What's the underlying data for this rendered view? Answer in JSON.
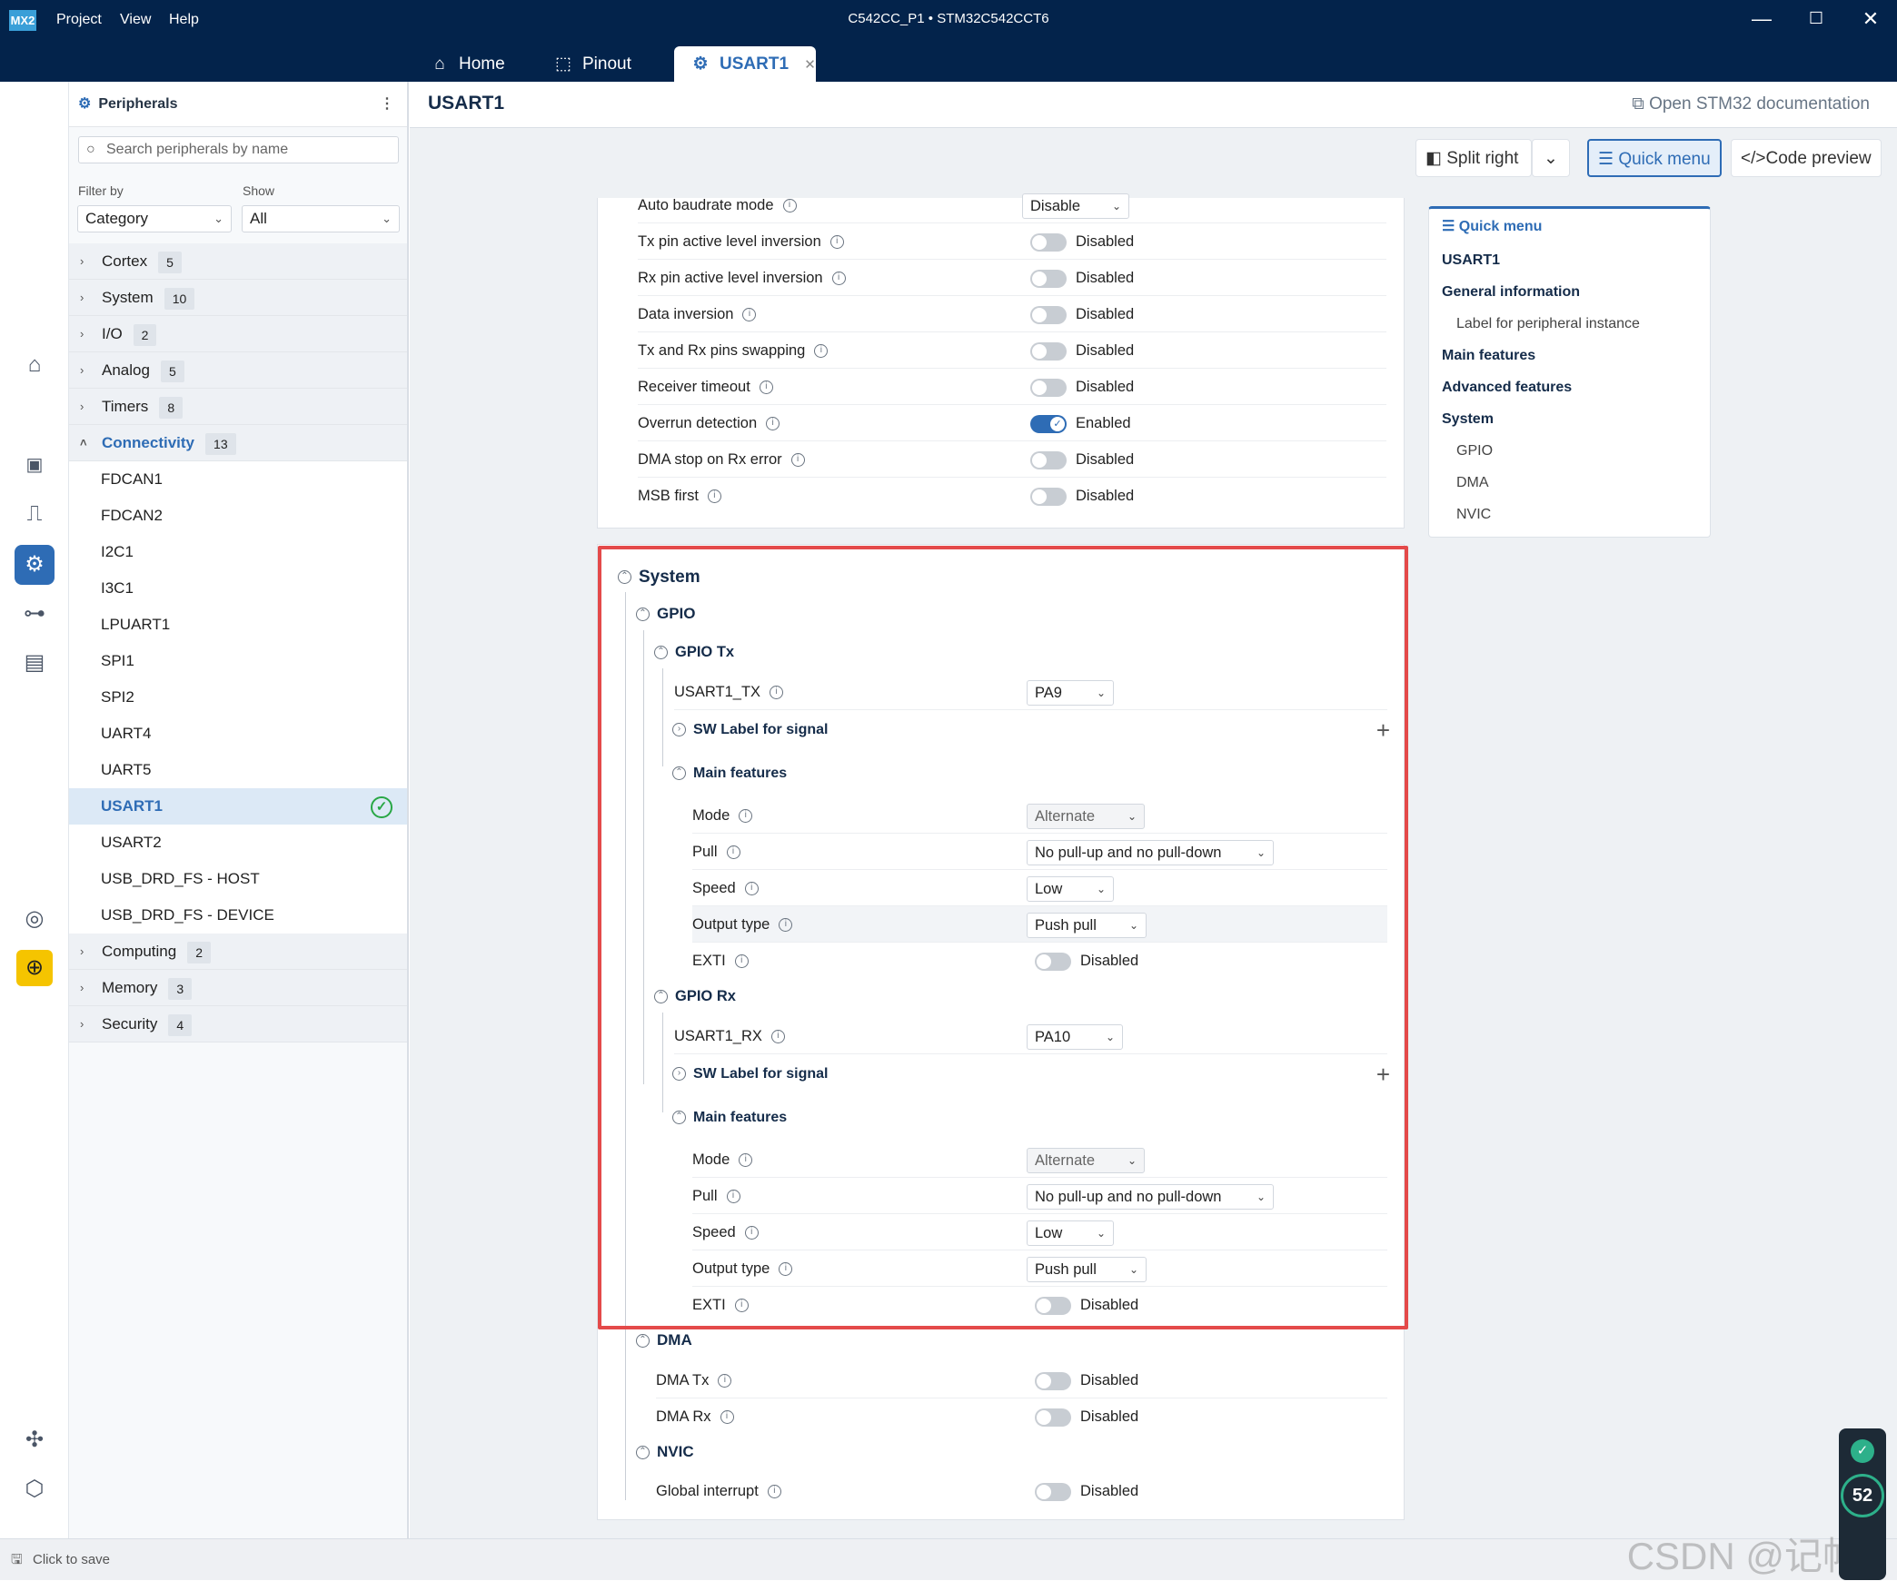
{
  "app": {
    "logo": "MX2",
    "menu": [
      "Project",
      "View",
      "Help"
    ],
    "window_title": "C542CC_P1  •  STM32C542CCT6"
  },
  "tabs": [
    {
      "label": "Home",
      "icon": "home-icon"
    },
    {
      "label": "Pinout",
      "icon": "chip-icon"
    },
    {
      "label": "USART1",
      "icon": "peripherals-icon"
    }
  ],
  "sidebar": {
    "title": "Peripherals",
    "search_placeholder": "Search peripherals by name",
    "filter_label": "Filter by",
    "filter_value": "Category",
    "show_label": "Show",
    "show_value": "All",
    "categories": [
      {
        "label": "Cortex",
        "count": "5"
      },
      {
        "label": "System",
        "count": "10"
      },
      {
        "label": "I/O",
        "count": "2"
      },
      {
        "label": "Analog",
        "count": "5"
      },
      {
        "label": "Timers",
        "count": "8"
      },
      {
        "label": "Connectivity",
        "count": "13"
      }
    ],
    "connectivity_items": [
      "FDCAN1",
      "FDCAN2",
      "I2C1",
      "I3C1",
      "LPUART1",
      "SPI1",
      "SPI2",
      "UART4",
      "UART5",
      "USART1",
      "USART2",
      "USB_DRD_FS - HOST",
      "USB_DRD_FS - DEVICE"
    ],
    "categories_after": [
      {
        "label": "Computing",
        "count": "2"
      },
      {
        "label": "Memory",
        "count": "3"
      },
      {
        "label": "Security",
        "count": "4"
      }
    ]
  },
  "main": {
    "title": "USART1",
    "doc_link": "Open STM32 documentation",
    "toolbar": {
      "split": "Split right",
      "quick_menu": "Quick menu",
      "code_preview": "Code preview"
    },
    "advanced_rows": [
      {
        "label": "Auto baudrate mode",
        "value": "Disable",
        "type": "select"
      },
      {
        "label": "Tx pin active level inversion",
        "value": "Disabled",
        "type": "toggle"
      },
      {
        "label": "Rx pin active level inversion",
        "value": "Disabled",
        "type": "toggle"
      },
      {
        "label": "Data inversion",
        "value": "Disabled",
        "type": "toggle"
      },
      {
        "label": "Tx and Rx pins swapping",
        "value": "Disabled",
        "type": "toggle"
      },
      {
        "label": "Receiver timeout",
        "value": "Disabled",
        "type": "toggle"
      },
      {
        "label": "Overrun detection",
        "value": "Enabled",
        "type": "toggle-on"
      },
      {
        "label": "DMA stop on Rx error",
        "value": "Disabled",
        "type": "toggle"
      },
      {
        "label": "MSB first",
        "value": "Disabled",
        "type": "toggle"
      }
    ],
    "system": {
      "title": "System",
      "gpio": "GPIO",
      "gpio_tx": {
        "title": "GPIO Tx",
        "pin_label": "USART1_TX",
        "pin_value": "PA9",
        "sw_label": "SW Label for signal",
        "main_features": "Main features",
        "rows": [
          {
            "label": "Mode",
            "value": "Alternate"
          },
          {
            "label": "Pull",
            "value": "No pull-up and no pull-down"
          },
          {
            "label": "Speed",
            "value": "Low"
          },
          {
            "label": "Output type",
            "value": "Push pull"
          },
          {
            "label": "EXTI",
            "value": "Disabled"
          }
        ]
      },
      "gpio_rx": {
        "title": "GPIO Rx",
        "pin_label": "USART1_RX",
        "pin_value": "PA10",
        "sw_label": "SW Label for signal",
        "main_features": "Main features",
        "rows": [
          {
            "label": "Mode",
            "value": "Alternate"
          },
          {
            "label": "Pull",
            "value": "No pull-up and no pull-down"
          },
          {
            "label": "Speed",
            "value": "Low"
          },
          {
            "label": "Output type",
            "value": "Push pull"
          },
          {
            "label": "EXTI",
            "value": "Disabled"
          }
        ]
      },
      "dma": {
        "title": "DMA",
        "rows": [
          {
            "label": "DMA Tx",
            "value": "Disabled"
          },
          {
            "label": "DMA Rx",
            "value": "Disabled"
          }
        ]
      },
      "nvic": {
        "title": "NVIC",
        "rows": [
          {
            "label": "Global interrupt",
            "value": "Disabled"
          }
        ]
      }
    }
  },
  "quick_menu": {
    "title": "Quick menu",
    "items": [
      {
        "label": "USART1",
        "level": 1
      },
      {
        "label": "General information",
        "level": 1
      },
      {
        "label": "Label for peripheral instance",
        "level": 2
      },
      {
        "label": "Main features",
        "level": 1
      },
      {
        "label": "Advanced features",
        "level": 1
      },
      {
        "label": "System",
        "level": 1
      },
      {
        "label": "GPIO",
        "level": 2
      },
      {
        "label": "DMA",
        "level": 2
      },
      {
        "label": "NVIC",
        "level": 2
      }
    ]
  },
  "status": {
    "save": "Click to save",
    "score": "52",
    "watermark": "CSDN @记帖"
  },
  "colors": {
    "titlebar": "#03234b",
    "accent": "#2e6cb5",
    "highlight_box": "#e44a4a"
  }
}
